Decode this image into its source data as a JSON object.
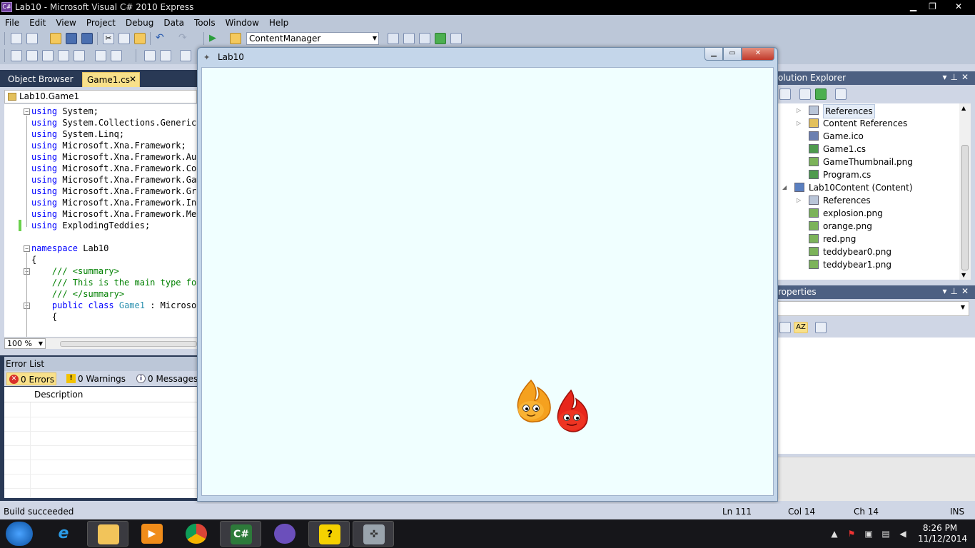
{
  "window": {
    "title": "Lab10 - Microsoft Visual C# 2010 Express",
    "app_icon": "csharp-icon"
  },
  "menu": [
    "File",
    "Edit",
    "View",
    "Project",
    "Debug",
    "Data",
    "Tools",
    "Window",
    "Help"
  ],
  "toolbar": {
    "combo_value": "ContentManager"
  },
  "doc_tabs": {
    "object_browser": "Object Browser",
    "game1": "Game1.cs",
    "close_glyph": "✕"
  },
  "nav_combo": "Lab10.Game1",
  "code_lines": [
    [
      {
        "t": "using",
        "c": "kw"
      },
      {
        "t": " System;",
        "c": ""
      }
    ],
    [
      {
        "t": "using",
        "c": "kw"
      },
      {
        "t": " System.Collections.Generic;",
        "c": ""
      }
    ],
    [
      {
        "t": "using",
        "c": "kw"
      },
      {
        "t": " System.Linq;",
        "c": ""
      }
    ],
    [
      {
        "t": "using",
        "c": "kw"
      },
      {
        "t": " Microsoft.Xna.Framework;",
        "c": ""
      }
    ],
    [
      {
        "t": "using",
        "c": "kw"
      },
      {
        "t": " Microsoft.Xna.Framework.Aud",
        "c": ""
      }
    ],
    [
      {
        "t": "using",
        "c": "kw"
      },
      {
        "t": " Microsoft.Xna.Framework.Con",
        "c": ""
      }
    ],
    [
      {
        "t": "using",
        "c": "kw"
      },
      {
        "t": " Microsoft.Xna.Framework.Gam",
        "c": ""
      }
    ],
    [
      {
        "t": "using",
        "c": "kw"
      },
      {
        "t": " Microsoft.Xna.Framework.Gra",
        "c": ""
      }
    ],
    [
      {
        "t": "using",
        "c": "kw"
      },
      {
        "t": " Microsoft.Xna.Framework.Inp",
        "c": ""
      }
    ],
    [
      {
        "t": "using",
        "c": "kw"
      },
      {
        "t": " Microsoft.Xna.Framework.Med",
        "c": ""
      }
    ],
    [
      {
        "t": "using",
        "c": "kw"
      },
      {
        "t": " ExplodingTeddies;",
        "c": ""
      }
    ],
    [],
    [
      {
        "t": "namespace",
        "c": "kw"
      },
      {
        "t": " Lab10",
        "c": ""
      }
    ],
    [
      {
        "t": "{",
        "c": ""
      }
    ],
    [
      {
        "t": "    /// <summary>",
        "c": "cm"
      }
    ],
    [
      {
        "t": "    /// This is the main type for",
        "c": "cm"
      }
    ],
    [
      {
        "t": "    /// </summary>",
        "c": "cm"
      }
    ],
    [
      {
        "t": "    ",
        "c": ""
      },
      {
        "t": "public",
        "c": "kw"
      },
      {
        "t": " ",
        "c": ""
      },
      {
        "t": "class",
        "c": "kw"
      },
      {
        "t": " ",
        "c": ""
      },
      {
        "t": "Game1",
        "c": "ty"
      },
      {
        "t": " : Microsof",
        "c": ""
      }
    ],
    [
      {
        "t": "    {",
        "c": ""
      }
    ]
  ],
  "zoom": "100 %",
  "error_list": {
    "title": "Error List",
    "errors": "0 Errors",
    "warnings": "0 Warnings",
    "messages": "0 Messages",
    "col_description": "Description"
  },
  "solution_explorer": {
    "title": "olution Explorer",
    "items": [
      {
        "label": "References",
        "icon": "references-icon",
        "arrow": "▷",
        "indent": 2,
        "selected": true
      },
      {
        "label": "Content References",
        "icon": "content-references-icon",
        "arrow": "▷",
        "indent": 2
      },
      {
        "label": "Game.ico",
        "icon": "ico-file-icon",
        "arrow": "",
        "indent": 2
      },
      {
        "label": "Game1.cs",
        "icon": "csharp-file-icon",
        "arrow": "",
        "indent": 2
      },
      {
        "label": "GameThumbnail.png",
        "icon": "image-file-icon",
        "arrow": "",
        "indent": 2
      },
      {
        "label": "Program.cs",
        "icon": "csharp-file-icon",
        "arrow": "",
        "indent": 2
      },
      {
        "label": "Lab10Content (Content)",
        "icon": "content-project-icon",
        "arrow": "◢",
        "indent": 1
      },
      {
        "label": "References",
        "icon": "references-icon",
        "arrow": "▷",
        "indent": 2
      },
      {
        "label": "explosion.png",
        "icon": "image-file-icon",
        "arrow": "",
        "indent": 2
      },
      {
        "label": "orange.png",
        "icon": "image-file-icon",
        "arrow": "",
        "indent": 2
      },
      {
        "label": "red.png",
        "icon": "image-file-icon",
        "arrow": "",
        "indent": 2
      },
      {
        "label": "teddybear0.png",
        "icon": "image-file-icon",
        "arrow": "",
        "indent": 2
      },
      {
        "label": "teddybear1.png",
        "icon": "image-file-icon",
        "arrow": "",
        "indent": 2
      }
    ]
  },
  "properties": {
    "title": "roperties"
  },
  "game_window": {
    "title": "Lab10",
    "background": "#f0ffff"
  },
  "status": {
    "message": "Build succeeded",
    "line": "Ln 111",
    "col": "Col 14",
    "ch": "Ch 14",
    "mode": "INS"
  },
  "taskbar": {
    "time": "8:26 PM",
    "date": "11/12/2014",
    "apps": [
      "ie-icon",
      "file-explorer-icon",
      "media-player-icon",
      "chrome-icon",
      "visual-csharp-icon",
      "cat-app-icon",
      "help-icon",
      "game-controller-icon"
    ]
  }
}
